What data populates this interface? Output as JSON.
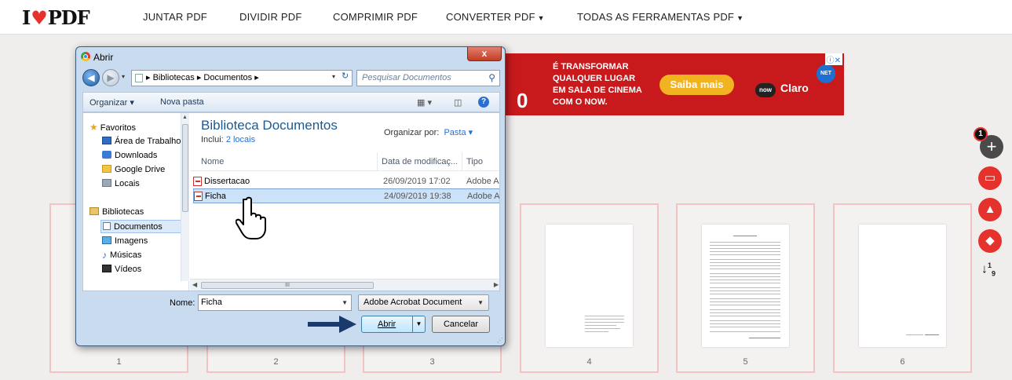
{
  "site": {
    "logo_left": "I",
    "logo_right": "PDF",
    "nav": {
      "merge": "JUNTAR PDF",
      "split": "DIVIDIR PDF",
      "compress": "COMPRIMIR PDF",
      "convert": "CONVERTER PDF",
      "all_tools": "TODAS AS FERRAMENTAS PDF"
    }
  },
  "ad": {
    "line1": "É TRANSFORMAR",
    "line2": "QUALQUER LUGAR",
    "line3": "EM SALA DE CINEMA",
    "line4": "COM O NOW.",
    "cta": "Saiba mais",
    "partial_char": "0",
    "brand_now": "now",
    "brand_claro": "Claro",
    "brand_net": "NET"
  },
  "tools": {
    "file_count_badge": "1"
  },
  "pages": [
    "1",
    "2",
    "3",
    "4",
    "5",
    "6"
  ],
  "dialog": {
    "title": "Abrir",
    "close_label": "x",
    "path": "▸ Bibliotecas ▸ Documentos ▸",
    "search_placeholder": "Pesquisar Documentos",
    "toolbar": {
      "organize": "Organizar ▾",
      "new_folder": "Nova pasta"
    },
    "nav_pane": {
      "favorites": "Favoritos",
      "desktop": "Área de Trabalho",
      "downloads": "Downloads",
      "google_drive": "Google Drive",
      "locations": "Locais",
      "libraries": "Bibliotecas",
      "documents": "Documentos",
      "images": "Imagens",
      "music": "Músicas",
      "videos": "Vídeos"
    },
    "library_title": "Biblioteca Documentos",
    "library_includes": "Inclui:",
    "library_locations": "2 locais",
    "organize_by": "Organizar por:",
    "organize_by_value": "Pasta ▾",
    "columns": {
      "name": "Nome",
      "modified": "Data de modificaç...",
      "type": "Tipo"
    },
    "files": [
      {
        "name": "Dissertacao",
        "modified": "26/09/2019 17:02",
        "type": "Adobe Ac"
      },
      {
        "name": "Ficha",
        "modified": "24/09/2019 19:38",
        "type": "Adobe Ac"
      }
    ],
    "scroll_grip": "III",
    "filename_label": "Nome:",
    "filename_value": "Ficha",
    "filetype_value": "Adobe Acrobat Document",
    "open_button": "Abrir",
    "cancel_button": "Cancelar"
  },
  "colors": {
    "accent": "#e5322d",
    "dialog_frame": "#c9dcef",
    "ad_bg": "#c8191c",
    "annotation_arrow": "#1a3a6e"
  }
}
